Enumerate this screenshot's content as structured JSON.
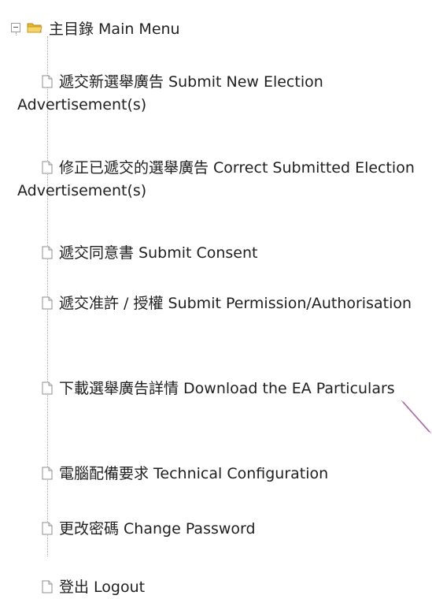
{
  "root": {
    "label": "主目錄 Main Menu",
    "icon": "folder-open-icon",
    "folder_color": "#f3c94d"
  },
  "items": [
    {
      "label": "遞交新選舉廣告 Submit New Election Advertisement(s)",
      "icon": "document-icon"
    },
    {
      "label": "修正已遞交的選舉廣告 Correct Submitted Election Advertisement(s)",
      "icon": "document-icon"
    },
    {
      "label": "遞交同意書 Submit Consent",
      "icon": "document-icon"
    },
    {
      "label": "遞交准許 / 授權 Submit Permission/Authorisation",
      "icon": "document-icon"
    },
    {
      "label": "下載選舉廣告詳情 Download the EA Particulars",
      "icon": "document-icon"
    },
    {
      "label": "電腦配備要求 Technical Configuration",
      "icon": "document-icon"
    },
    {
      "label": "更改密碼 Change Password",
      "icon": "document-icon"
    },
    {
      "label": "登出 Logout",
      "icon": "document-icon"
    }
  ],
  "colors": {
    "text": "#1f1f1f",
    "tree_line": "#a8a8a8",
    "arrow": "#7a2a78"
  }
}
